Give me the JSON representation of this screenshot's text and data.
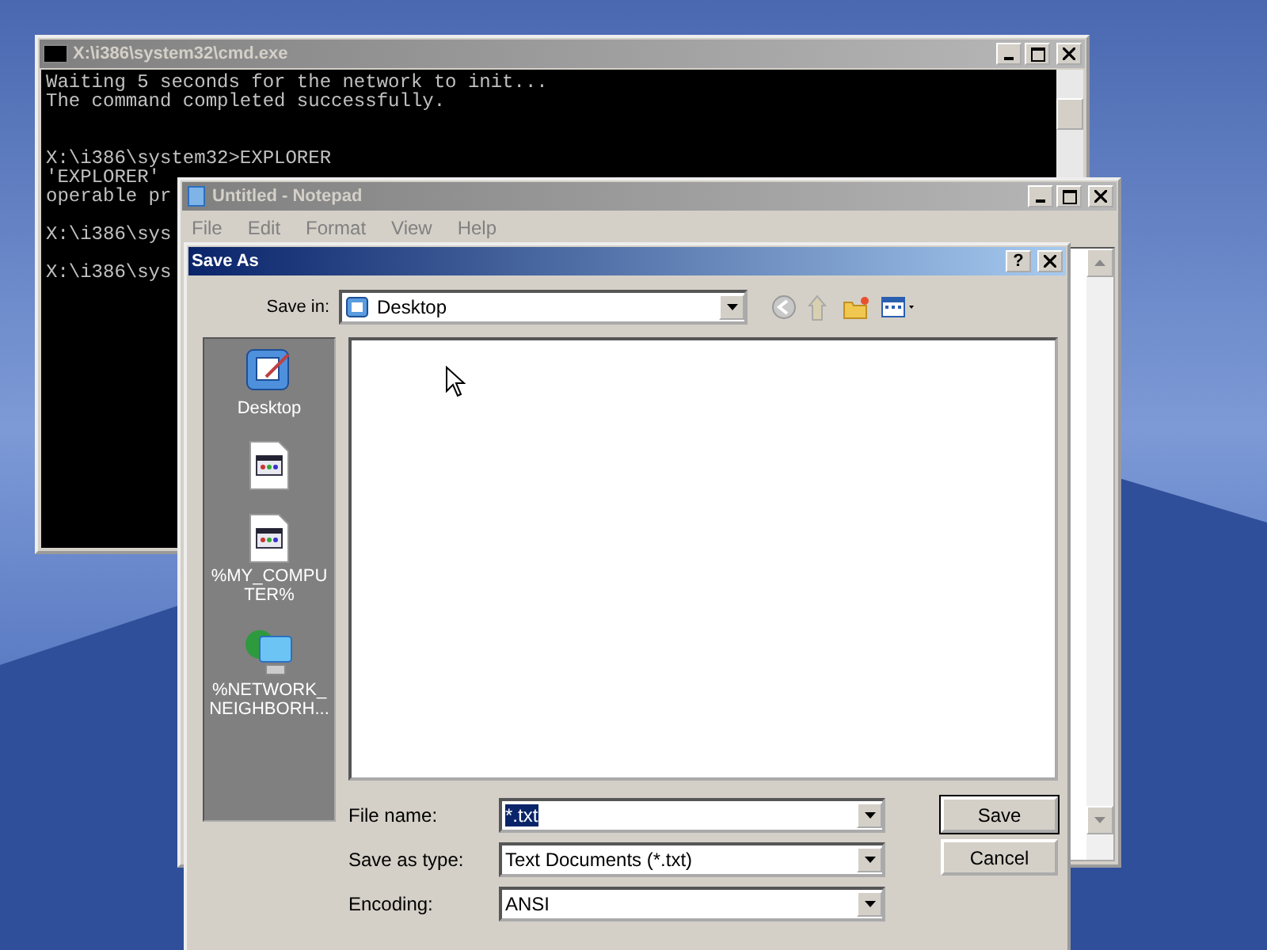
{
  "console": {
    "title": "X:\\i386\\system32\\cmd.exe",
    "blocks": [
      [
        "Waiting 5 seconds for the network to init...",
        "The command completed successfully."
      ],
      [
        "X:\\i386\\system32>EXPLORER",
        "'EXPLORER'",
        "operable pr"
      ],
      [
        "X:\\i386\\sys"
      ],
      [
        "X:\\i386\\sys"
      ]
    ]
  },
  "notepad": {
    "title": "Untitled - Notepad",
    "menu": [
      "File",
      "Edit",
      "Format",
      "View",
      "Help"
    ]
  },
  "save_as": {
    "title": "Save As",
    "help_button": "?",
    "save_in": {
      "label": "Save in:",
      "value": "Desktop"
    },
    "places": [
      {
        "kind": "desktop",
        "label": "Desktop"
      },
      {
        "kind": "document"
      },
      {
        "kind": "document",
        "label": "%MY_COMPUTER%"
      },
      {
        "kind": "network",
        "label": "%NETWORK_NEIGHBORH..."
      }
    ],
    "fields": [
      {
        "label": "File name:",
        "value": "*.txt",
        "highlighted": true
      },
      {
        "label": "Save as type:",
        "value": "Text Documents (*.txt)",
        "highlighted": false
      },
      {
        "label": "Encoding:",
        "value": "ANSI",
        "highlighted": false
      }
    ],
    "buttons": [
      {
        "label": "Save",
        "default": true
      },
      {
        "label": "Cancel",
        "default": false
      }
    ]
  }
}
